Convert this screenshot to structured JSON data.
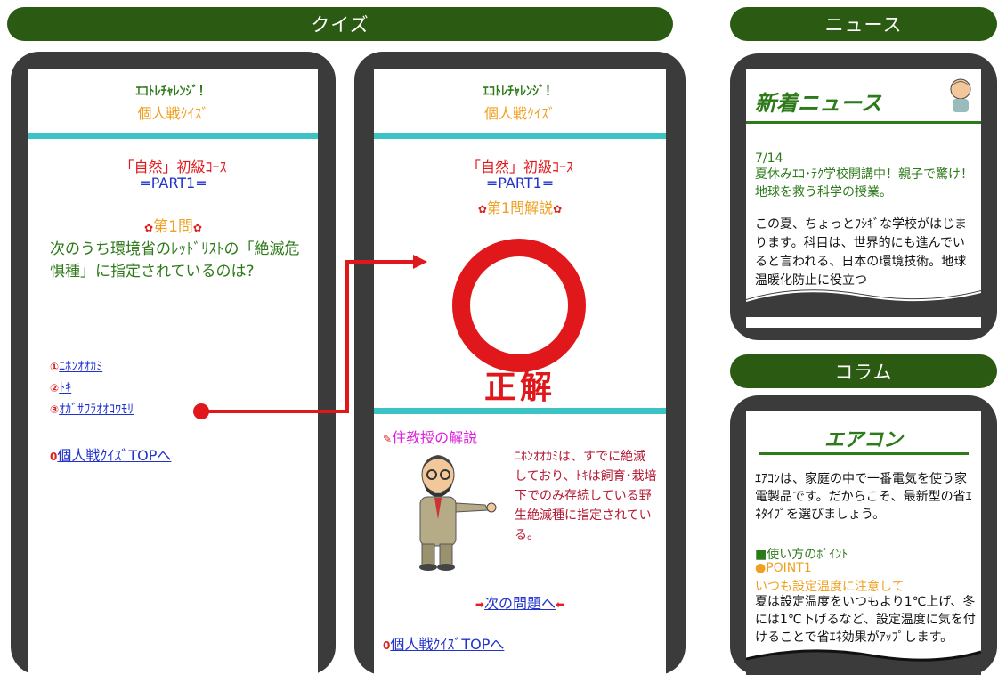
{
  "banners": {
    "quiz": "クイズ",
    "news": "ニュース",
    "column": "コラム"
  },
  "left_phone": {
    "brand": "ｴｺﾄﾚﾁｬﾚﾝｼﾞ！",
    "mode": "個人戦ｸｲｽﾞ",
    "course": "「自然」初級ｺｰｽ",
    "part": "=PART1=",
    "qnum": "第1問",
    "question": "次のうち環境省のﾚｯﾄﾞﾘｽﾄの「絶滅危惧種」に指定されているのは?",
    "choices": [
      {
        "mark": "①",
        "label": "ﾆﾎﾝｵｵｶﾐ"
      },
      {
        "mark": "②",
        "label": "ﾄｷ"
      },
      {
        "mark": "③",
        "label": "ｵｶﾞｻﾜﾗｵｵｺｳﾓﾘ"
      }
    ],
    "top_mark": "0",
    "top_link": "個人戦ｸｲｽﾞTOPへ"
  },
  "right_phone": {
    "brand": "ｴｺﾄﾚﾁｬﾚﾝｼﾞ！",
    "mode": "個人戦ｸｲｽﾞ",
    "course": "「自然」初級ｺｰｽ",
    "part": "=PART1=",
    "explain_title": "第1問解説",
    "result": "正解",
    "professor_title": "住教授の解説",
    "explanation": "ﾆﾎﾝｵｵｶﾐは、すでに絶滅しており、ﾄｷは飼育･栽培下でのみ存続している野生絶滅種に指定されている。",
    "next_link": "次の問題へ",
    "top_link": "個人戦ｸｲｽﾞTOPへ"
  },
  "news": {
    "heading": "新着ニュース",
    "date": "7/14",
    "headline": "夏休みｴｺ･ﾃｸ学校開講中！親子で驚け！地球を救う科学の授業。",
    "body": "この夏、ちょっとﾌｼｷﾞな学校がはじまります。科目は、世界的にも進んでいると言われる、日本の環境技術。地球温暖化防止に役立つ"
  },
  "column": {
    "heading": "エアコン",
    "intro": "ｴｱｺﾝは、家庭の中で一番電気を使う家電製品です。だからこそ、最新型の省ｴﾈﾀｲﾌﾟを選びましょう。",
    "section": "■使い方のﾎﾟｲﾝﾄ",
    "point": "●POINT1",
    "point_title": "いつも設定温度に注意して",
    "point_body": "夏は設定温度をいつもより1℃上げ、冬には1℃下げるなど、設定温度に気を付けることで省ｴﾈ効果がｱｯﾌﾟします。"
  },
  "colors": {
    "banner": "#2b5a12",
    "teal": "#3cc4c4",
    "green": "#2d7a1a",
    "orange": "#f0a020",
    "red": "#e0181b",
    "blue": "#2233cc",
    "magenta": "#e020e0"
  }
}
